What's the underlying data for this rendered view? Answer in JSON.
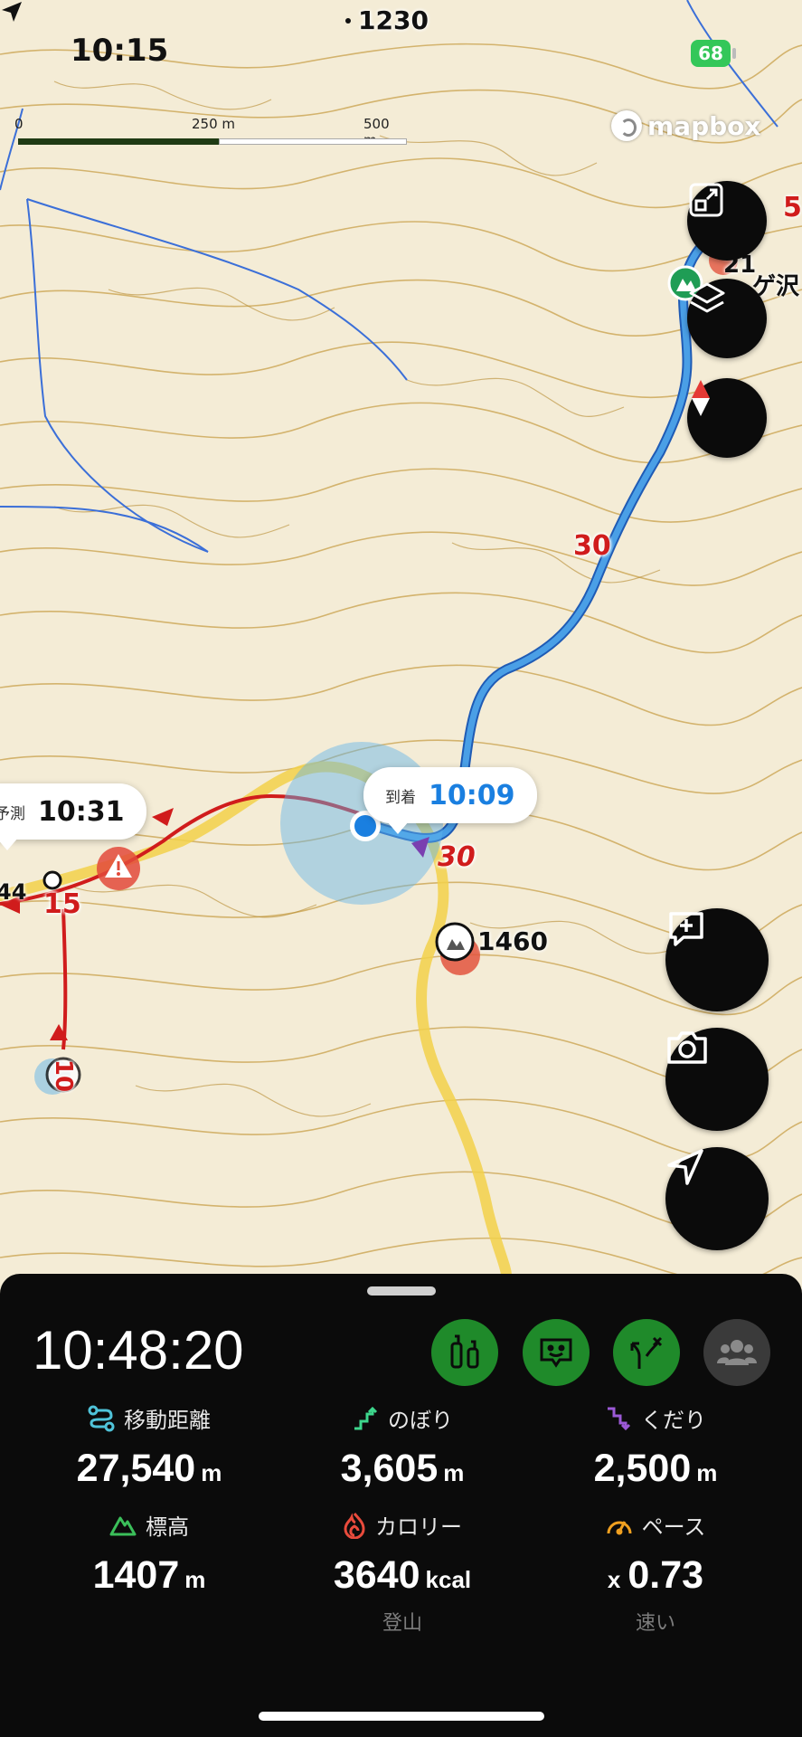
{
  "status_bar": {
    "time": "10:15",
    "battery": "68"
  },
  "map": {
    "scale": {
      "zero": "0",
      "mid": "250 m",
      "max": "500 m"
    },
    "attribution": "mapbox",
    "peaks": {
      "top": "1230",
      "mid": "1460"
    },
    "partial_labels": {
      "left_elevation": "44",
      "right_top": "5",
      "right_peak": "21",
      "right_name": "ゲ沢"
    },
    "bubble_left": {
      "tag": "予測",
      "time": "10:31"
    },
    "bubble_arrival": {
      "tag": "到着",
      "time": "10:09"
    },
    "km_markers": [
      "30",
      "30",
      "15",
      "10",
      "10"
    ]
  },
  "panel": {
    "elapsed": "10:48:20",
    "modes": [
      "trail-mode-icon",
      "face-mode-icon",
      "route-mode-icon",
      "group-icon"
    ],
    "stats": [
      {
        "label": "移動距離",
        "value": "27,540",
        "unit": "m",
        "icon": "distance-icon",
        "color": "#4fc3d9"
      },
      {
        "label": "のぼり",
        "value": "3,605",
        "unit": "m",
        "icon": "ascent-icon",
        "color": "#3dd68c"
      },
      {
        "label": "くだり",
        "value": "2,500",
        "unit": "m",
        "icon": "descent-icon",
        "color": "#9b59d6"
      },
      {
        "label": "標高",
        "value": "1407",
        "unit": "m",
        "icon": "elevation-icon",
        "color": "#3bbf5a"
      },
      {
        "label": "カロリー",
        "value": "3640",
        "unit": "kcal",
        "icon": "calorie-icon",
        "color": "#e94b3c",
        "note": "登山"
      },
      {
        "label": "ペース",
        "value": "0.73",
        "prefix": "x",
        "icon": "pace-icon",
        "color": "#f0a020",
        "note": "速い"
      }
    ]
  }
}
